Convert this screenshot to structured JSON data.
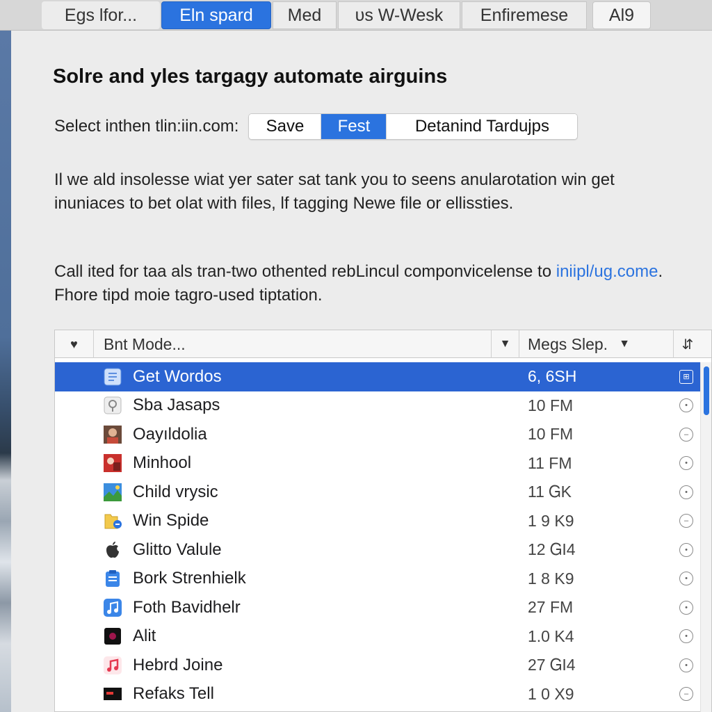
{
  "tabs": [
    {
      "label": "Egs lfor...",
      "active": false
    },
    {
      "label": "Eln spard",
      "active": true
    },
    {
      "label": "Med",
      "active": false
    },
    {
      "label": "ᴜs W-Wesk",
      "active": false
    },
    {
      "label": "Enfiremese",
      "active": false
    },
    {
      "label": "Al9",
      "active": false
    }
  ],
  "heading": "Solre and yles targagy automate airguins",
  "select": {
    "label": "Select inthen tlin:iin.com:",
    "options": [
      "Save",
      "Fest",
      "Detanind Tardujps"
    ],
    "selected": "Fest"
  },
  "paragraph1": "Il we ald insolesse wiat yer sater sat tank you to seens anularotation win get inuniaces to bet olat with files, lf tagging Newe file or ellissties.",
  "paragraph2": {
    "before": "Call ited for taa als tran-two othented rebLincul componvicelense to ",
    "link": "iniipl/ug.come",
    "after": ". Fhore tipd moie tagro-used tiptation."
  },
  "table": {
    "columns": {
      "favorite_icon": "heart-icon",
      "name": "Bnt Mode...",
      "size": "Megs Slep."
    },
    "rows": [
      {
        "name": "Get Wordos",
        "size": "6, 6SH",
        "icon": "document-icon",
        "selected": true
      },
      {
        "name": "Sba Jasaps",
        "size": "10 FM",
        "icon": "location-pin-icon",
        "selected": false
      },
      {
        "name": "Oayıldolia",
        "size": "10 FM",
        "icon": "person-photo-icon",
        "selected": false
      },
      {
        "name": "Minhool",
        "size": "11 FM",
        "icon": "photo-icon",
        "selected": false
      },
      {
        "name": "Child vrysic",
        "size": "11 ᏀK",
        "icon": "landscape-icon",
        "selected": false
      },
      {
        "name": "Win Spide",
        "size": "1 9 K9",
        "icon": "folder-icon",
        "selected": false
      },
      {
        "name": "Glitto Valule",
        "size": "12 ᏀI4",
        "icon": "apple-icon",
        "selected": false
      },
      {
        "name": "Bork Strenhielk",
        "size": "1 8 K9",
        "icon": "clipboard-icon",
        "selected": false
      },
      {
        "name": "Foth Bavidhelr",
        "size": "27 FM",
        "icon": "music-note-icon",
        "selected": false
      },
      {
        "name": "Alit",
        "size": "1.0 K4",
        "icon": "dark-app-icon",
        "selected": false
      },
      {
        "name": "Hebrd Joine",
        "size": "27 ᏀI4",
        "icon": "music-app-icon",
        "selected": false
      },
      {
        "name": "Refaks Tell",
        "size": "1 0 X9",
        "icon": "video-icon",
        "selected": false
      }
    ]
  },
  "colors": {
    "accent": "#2b73df",
    "selection": "#2b64d2"
  }
}
